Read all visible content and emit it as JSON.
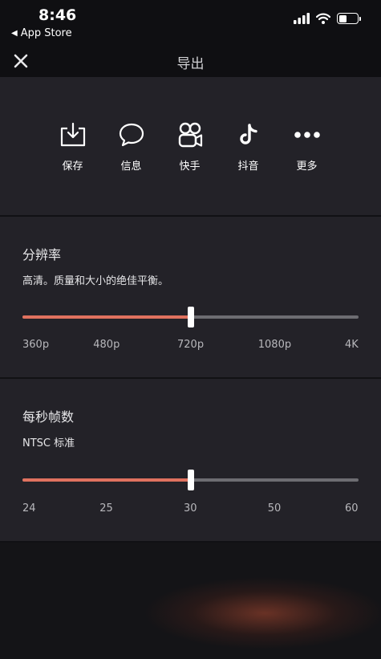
{
  "status_bar": {
    "time": "8:46",
    "back_app": "App Store",
    "battery_level": 0.45
  },
  "header": {
    "title": "导出"
  },
  "share": {
    "items": [
      {
        "label": "保存",
        "icon": "download-icon"
      },
      {
        "label": "信息",
        "icon": "chat-bubble-icon"
      },
      {
        "label": "快手",
        "icon": "kuaishou-icon"
      },
      {
        "label": "抖音",
        "icon": "douyin-icon"
      },
      {
        "label": "更多",
        "icon": "more-dots-icon"
      }
    ]
  },
  "resolution": {
    "title": "分辨率",
    "subtitle": "高清。质量和大小的绝佳平衡。",
    "options": [
      "360p",
      "480p",
      "720p",
      "1080p",
      "4K"
    ],
    "selected_index": 2
  },
  "fps": {
    "title": "每秒帧数",
    "subtitle": "NTSC 标准",
    "options": [
      "24",
      "25",
      "30",
      "50",
      "60"
    ],
    "selected_index": 2
  },
  "colors": {
    "accent": "#e0725f",
    "panel": "#232228",
    "track": "#6d6d72"
  }
}
